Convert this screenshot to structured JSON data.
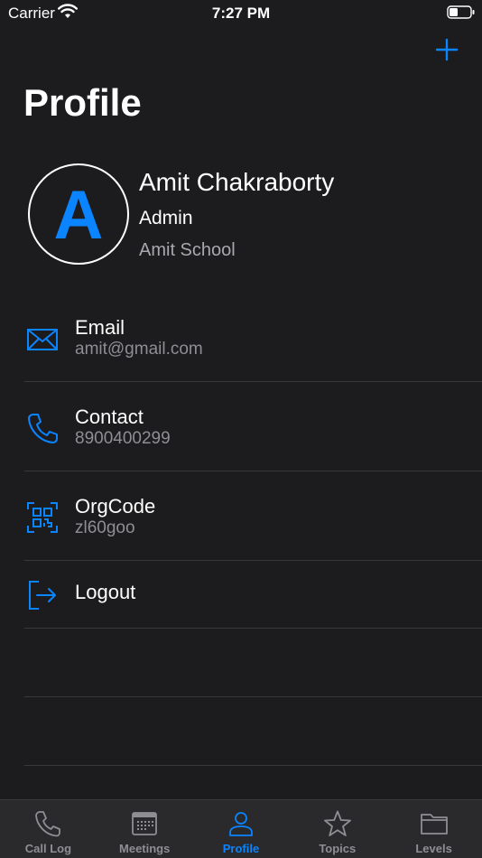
{
  "status_bar": {
    "carrier": "Carrier",
    "time": "7:27 PM"
  },
  "header": {
    "title": "Profile",
    "add_icon": "plus-icon"
  },
  "profile": {
    "initial": "A",
    "name": "Amit Chakraborty",
    "role": "Admin",
    "organization": "Amit School"
  },
  "menu": [
    {
      "icon": "mail-icon",
      "label": "Email",
      "value": "amit@gmail.com"
    },
    {
      "icon": "phone-icon",
      "label": "Contact",
      "value": "8900400299"
    },
    {
      "icon": "qr-code-icon",
      "label": "OrgCode",
      "value": "zl60goo"
    },
    {
      "icon": "logout-icon",
      "label": "Logout"
    }
  ],
  "tabs": [
    {
      "icon": "phone-icon",
      "label": "Call Log",
      "active": false
    },
    {
      "icon": "calendar-icon",
      "label": "Meetings",
      "active": false
    },
    {
      "icon": "person-icon",
      "label": "Profile",
      "active": true
    },
    {
      "icon": "star-icon",
      "label": "Topics",
      "active": false
    },
    {
      "icon": "folder-icon",
      "label": "Levels",
      "active": false
    }
  ],
  "colors": {
    "background": "#1c1c1e",
    "accent": "#0a84ff",
    "secondary_text": "#8e8e93",
    "tab_bar": "#2a2a2c"
  }
}
